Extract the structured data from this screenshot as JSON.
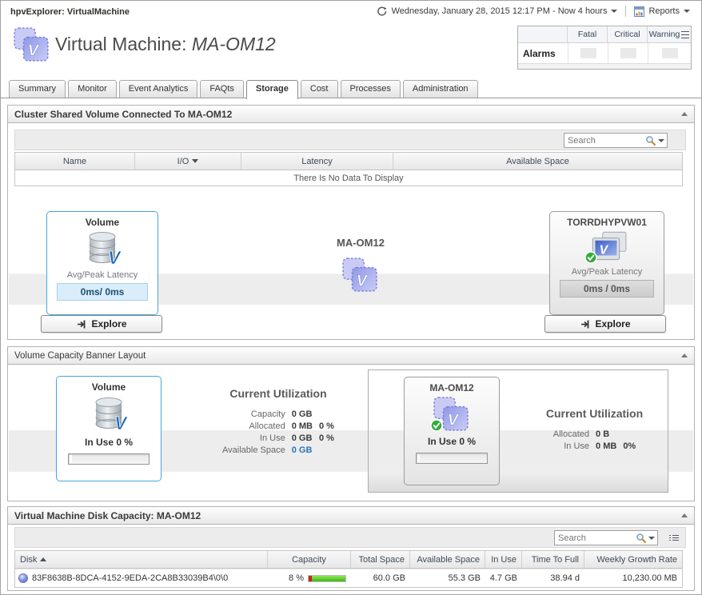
{
  "top": {
    "app_title": "hpvExplorer: VirtualMachine",
    "timerange_label": "Wednesday, January 28, 2015 12:17 PM - Now 4 hours",
    "reports_label": "Reports"
  },
  "header": {
    "title_prefix": "Virtual Machine: ",
    "title_name": "MA-OM12",
    "alarms": {
      "row_label": "Alarms",
      "columns": [
        "Fatal",
        "Critical",
        "Warning"
      ]
    }
  },
  "tabs": {
    "items": [
      {
        "label": "Summary"
      },
      {
        "label": "Monitor"
      },
      {
        "label": "Event Analytics"
      },
      {
        "label": "FAQts"
      },
      {
        "label": "Storage"
      },
      {
        "label": "Cost"
      },
      {
        "label": "Processes"
      },
      {
        "label": "Administration"
      }
    ],
    "active": "Storage"
  },
  "section_csv": {
    "title": "Cluster Shared Volume Connected To MA-OM12",
    "search_placeholder": "Search",
    "table": {
      "columns": [
        "Name",
        "I/O",
        "Latency",
        "Available Space"
      ],
      "sorted_by": "I/O",
      "empty_text": "There Is No Data To Display"
    },
    "volume_tile": {
      "title": "Volume",
      "metric_label": "Avg/Peak Latency",
      "metric_value": "0ms/ 0ms",
      "explore_label": "Explore"
    },
    "vm_label": "MA-OM12",
    "host_tile": {
      "title": "TORRDHYPVW01",
      "metric_label": "Avg/Peak Latency",
      "metric_value": "0ms / 0ms",
      "explore_label": "Explore"
    }
  },
  "section_capacity": {
    "title": "Volume Capacity Banner Layout",
    "volume_tile": {
      "title": "Volume",
      "in_use": "In Use 0 %"
    },
    "utilization_left": {
      "title": "Current Utilization",
      "rows": [
        {
          "label": "Capacity",
          "value": "0 GB",
          "pct": ""
        },
        {
          "label": "Allocated",
          "value": "0 MB",
          "pct": "0 %"
        },
        {
          "label": "In Use",
          "value": "0 GB",
          "pct": "0 %"
        },
        {
          "label": "Available Space",
          "value": "0 GB",
          "pct": ""
        }
      ]
    },
    "vm_tile": {
      "title": "MA-OM12",
      "in_use": "In Use 0 %"
    },
    "utilization_right": {
      "title": "Current Utilization",
      "rows": [
        {
          "label": "Allocated",
          "value": "0 B",
          "pct": ""
        },
        {
          "label": "In Use",
          "value": "0 MB",
          "pct": "0%"
        }
      ]
    }
  },
  "section_disk": {
    "title": "Virtual Machine Disk Capacity: MA-OM12",
    "search_placeholder": "Search",
    "table": {
      "columns": [
        "Disk",
        "Capacity",
        "Total Space",
        "Available Space",
        "In Use",
        "Time To Full",
        "Weekly Growth Rate"
      ],
      "sorted_by": "Disk",
      "rows": [
        {
          "disk": "83F8638B-8DCA-4152-9EDA-2CA8B33039B4\\0\\0",
          "capacity_pct": "8 %",
          "capacity_value": 8,
          "total_space": "60.0 GB",
          "available_space": "55.3 GB",
          "in_use": "4.7 GB",
          "time_to_full": "38.94 d",
          "weekly_growth_rate": "10,230.00 MB"
        }
      ]
    }
  },
  "colors": {
    "tile_blue_border": "#45a8da",
    "value_blue_bg": "#d9edfa",
    "link_blue": "#2b74b8",
    "capacity_used_red": "#cc2020",
    "capacity_free_green": "#3fb818"
  }
}
